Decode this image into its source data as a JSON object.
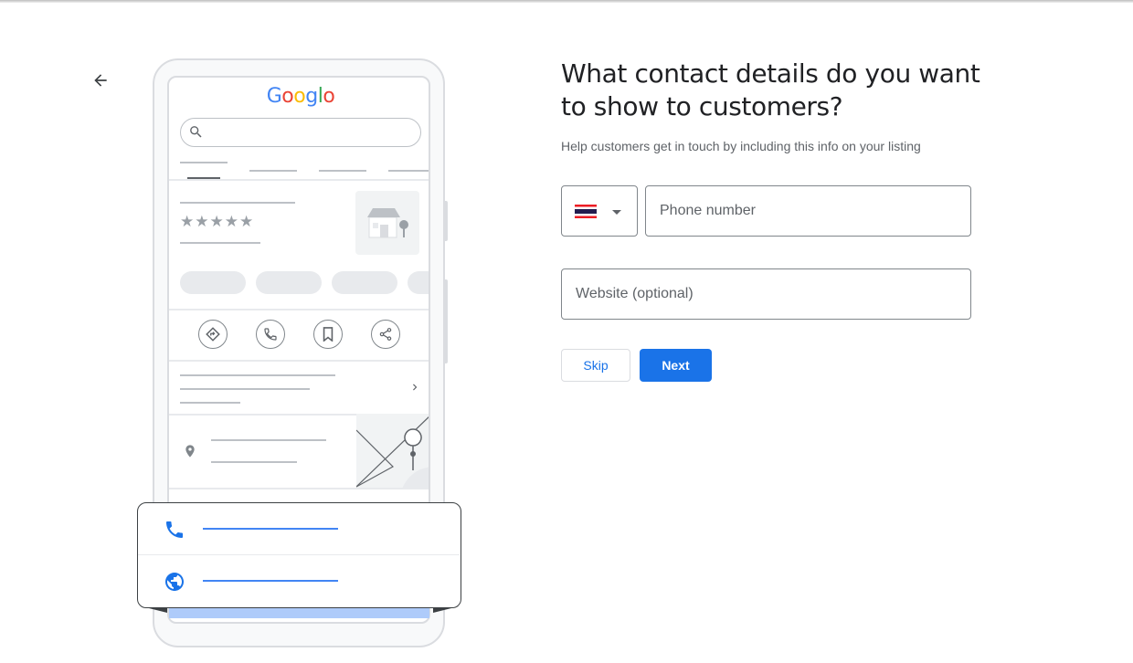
{
  "header": {
    "back_icon": "arrow-left-icon"
  },
  "illustration": {
    "logo_letters": [
      {
        "char": "G",
        "color": "#4285F4"
      },
      {
        "char": "o",
        "color": "#EA4335"
      },
      {
        "char": "o",
        "color": "#FBBC05"
      },
      {
        "char": "g",
        "color": "#4285F4"
      },
      {
        "char": "l",
        "color": "#34A853"
      },
      {
        "char": "o",
        "color": "#EA4335"
      }
    ],
    "stars": "★★★★★",
    "action_icons": [
      "directions-icon",
      "phone-icon",
      "bookmark-icon",
      "share-icon"
    ],
    "popup_icons": [
      "phone-icon",
      "globe-icon"
    ]
  },
  "form": {
    "title": "What contact details do you want to show to customers?",
    "subtitle": "Help customers get in touch by including this info on your listing",
    "country": {
      "flag_icon": "thailand-flag-icon"
    },
    "phone_placeholder": "Phone number",
    "website_placeholder": "Website (optional)",
    "skip_label": "Skip",
    "next_label": "Next"
  },
  "colors": {
    "accent": "#1a73e8",
    "popup_line": "#4285f4"
  }
}
